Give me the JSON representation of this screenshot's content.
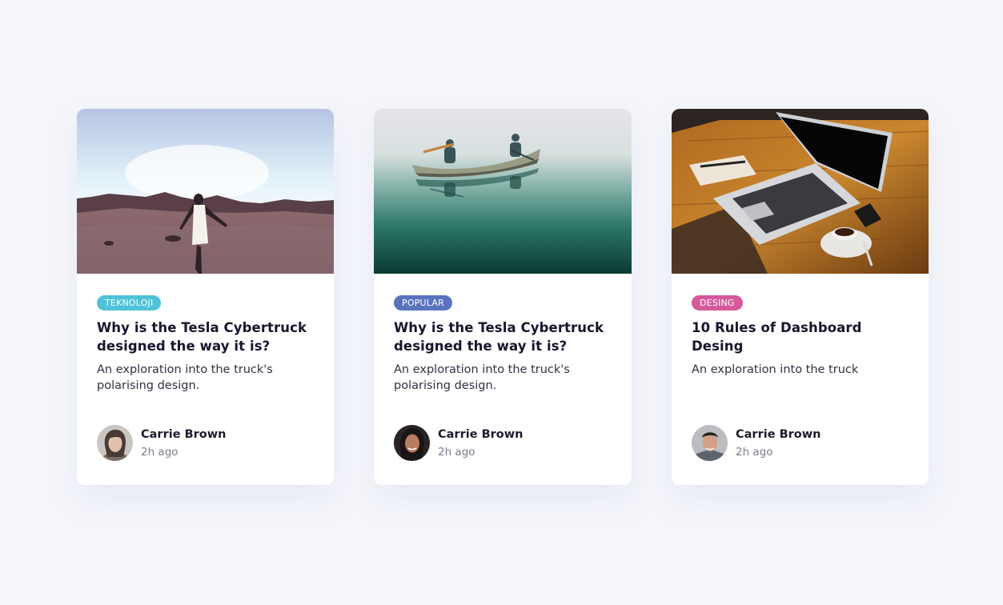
{
  "cards": [
    {
      "tag": "TEKNOLOJI",
      "tag_color": "#4fc2d7",
      "title": "Why is the Tesla Cybertruck designed the way it is?",
      "description": "An exploration into the truck's polarising design.",
      "author": "Carrie Brown",
      "time": "2h ago",
      "image": "woman-in-desert-photo",
      "avatar": "woman-avatar"
    },
    {
      "tag": "POPULAR",
      "tag_color": "#5a73bf",
      "title": "Why is the Tesla Cybertruck designed the way it is?",
      "description": "An exploration into the truck's polarising design.",
      "author": "Carrie Brown",
      "time": "2h ago",
      "image": "canoe-on-lake-photo",
      "avatar": "woman-avatar"
    },
    {
      "tag": "DESING",
      "tag_color": "#d45a9c",
      "title": "10 Rules of Dashboard Desing",
      "description": "An exploration into the truck",
      "author": "Carrie Brown",
      "time": "2h ago",
      "image": "laptop-on-desk-photo",
      "avatar": "man-avatar"
    }
  ]
}
